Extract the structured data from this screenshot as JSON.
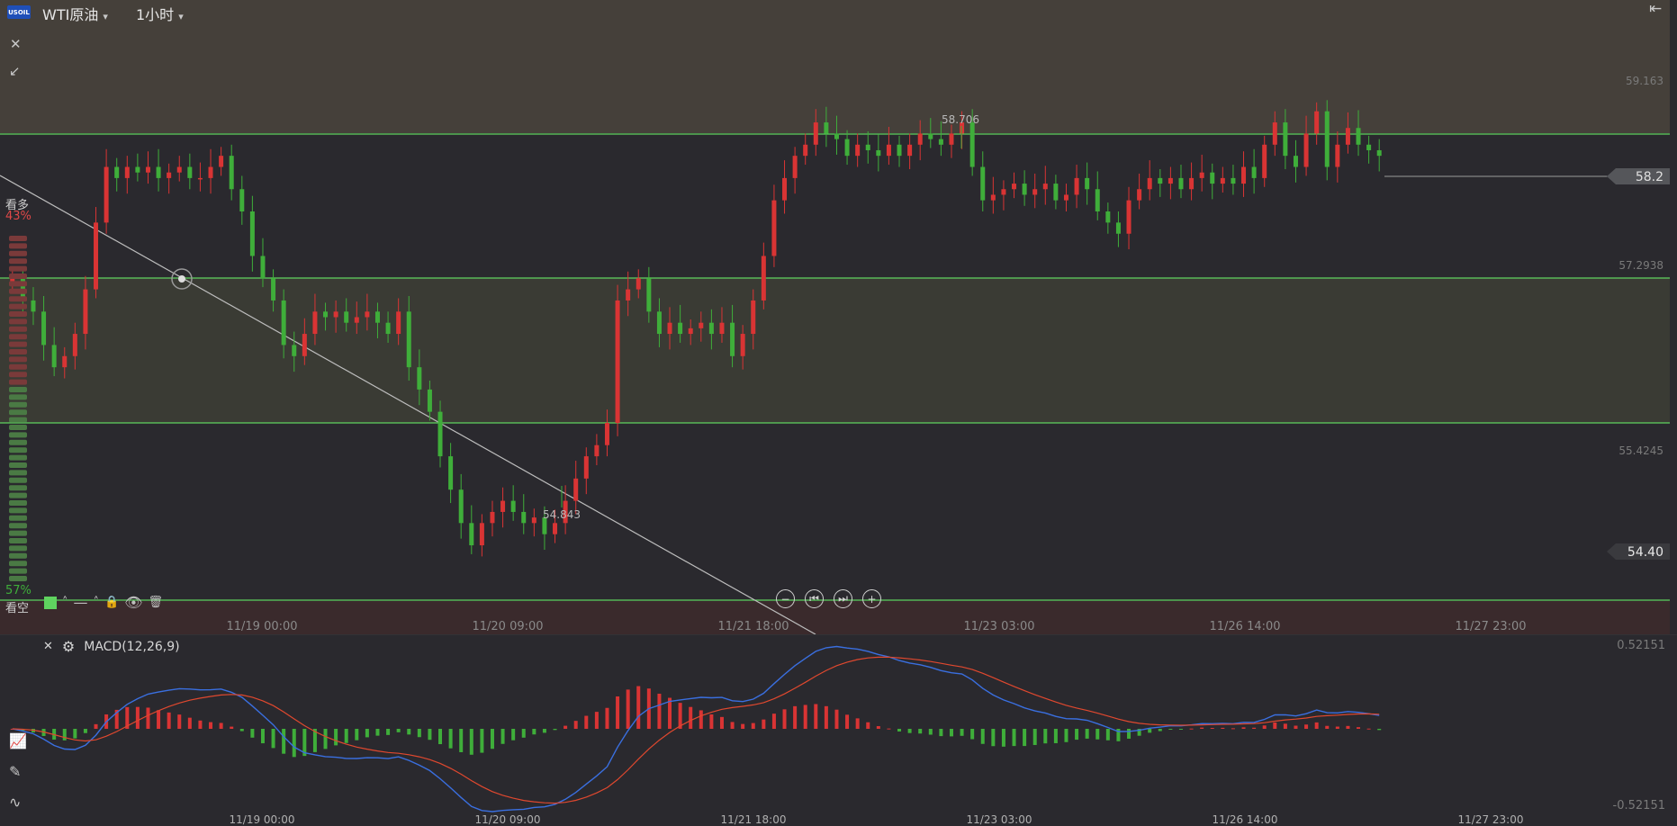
{
  "header": {
    "symbol_badge": "USOIL",
    "symbol": "WTI原油",
    "timeframe": "1小时"
  },
  "sentiment": {
    "bull_label": "看多",
    "bull_pct": "43%",
    "bear_label": "看空",
    "bear_pct": "57%"
  },
  "price_axis": {
    "labels": [
      "59.163",
      "57.2938",
      "55.4245"
    ],
    "current_price": "58.2",
    "marker_price": "54.40"
  },
  "annotations": {
    "high": "58.706",
    "low": "54.843"
  },
  "time_axis": [
    "11/19 00:00",
    "11/20 09:00",
    "11/21 18:00",
    "11/23 03:00",
    "11/26 14:00",
    "11/27 23:00"
  ],
  "macd": {
    "title": "MACD(12,26,9)",
    "top": "0.52151",
    "bottom": "-0.52151"
  },
  "colors": {
    "up": "#3fae3a",
    "down": "#d93434",
    "bg": "#2a292e",
    "level": "#5fd35f",
    "macd_line": "#3a6fe0",
    "signal_line": "#e0482e"
  },
  "chart_data": {
    "type": "candlestick",
    "y_range": [
      53.9,
      59.6
    ],
    "x_labels": [
      "11/19 00:00",
      "11/20 09:00",
      "11/21 18:00",
      "11/23 03:00",
      "11/26 14:00",
      "11/27 23:00"
    ],
    "closes": [
      57.1,
      56.9,
      56.8,
      56.5,
      56.3,
      56.4,
      56.6,
      57.0,
      57.6,
      58.1,
      58.0,
      58.1,
      58.05,
      58.1,
      58.0,
      58.05,
      58.1,
      58.0,
      58.0,
      58.1,
      58.2,
      57.9,
      57.7,
      57.3,
      57.1,
      56.9,
      56.5,
      56.4,
      56.6,
      56.8,
      56.75,
      56.8,
      56.7,
      56.75,
      56.8,
      56.7,
      56.6,
      56.8,
      56.3,
      56.1,
      55.9,
      55.5,
      55.2,
      54.9,
      54.7,
      54.9,
      55.0,
      55.1,
      55.0,
      54.9,
      54.95,
      54.8,
      54.9,
      55.1,
      55.3,
      55.5,
      55.6,
      55.8,
      56.9,
      57.0,
      57.1,
      56.8,
      56.6,
      56.7,
      56.6,
      56.65,
      56.7,
      56.6,
      56.7,
      56.4,
      56.6,
      56.9,
      57.3,
      57.8,
      58.0,
      58.2,
      58.3,
      58.5,
      58.4,
      58.35,
      58.2,
      58.3,
      58.25,
      58.2,
      58.3,
      58.2,
      58.3,
      58.4,
      58.35,
      58.3,
      58.4,
      58.5,
      58.1,
      57.8,
      57.85,
      57.9,
      57.95,
      57.85,
      57.9,
      57.95,
      57.8,
      57.85,
      58.0,
      57.9,
      57.7,
      57.6,
      57.5,
      57.8,
      57.9,
      58.0,
      57.95,
      58.0,
      57.9,
      58.0,
      58.05,
      57.95,
      58.0,
      57.95,
      58.1,
      58.0,
      58.3,
      58.5,
      58.2,
      58.1,
      58.4,
      58.6,
      58.1,
      58.3,
      58.45,
      58.3,
      58.25,
      58.2
    ]
  }
}
